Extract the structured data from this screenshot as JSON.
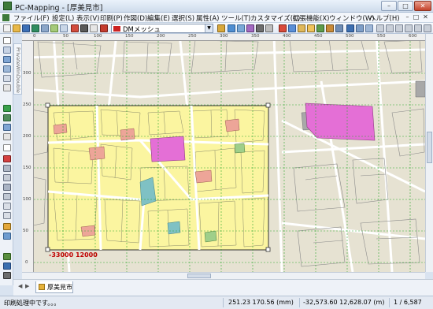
{
  "window": {
    "title": "PC-Mapping - [厚美見市]",
    "minimize_glyph": "–",
    "maximize_glyph": "□",
    "close_glyph": "✕"
  },
  "menu": {
    "items": [
      {
        "label": "ファイル(F)"
      },
      {
        "label": "設定(L)"
      },
      {
        "label": "表示(V)"
      },
      {
        "label": "印刷(P)"
      },
      {
        "label": "作図(D)"
      },
      {
        "label": "編集(E)"
      },
      {
        "label": "選択(S)"
      },
      {
        "label": "属性(A)"
      },
      {
        "label": "ツール(T)"
      },
      {
        "label": "カスタマイズ(C)"
      },
      {
        "label": "拡張機能(X)"
      },
      {
        "label": "ウィンドウ(W)"
      },
      {
        "label": "ヘルプ(H)"
      }
    ]
  },
  "toolbar": {
    "layer_select_value": "DMメッシュ"
  },
  "palette": {
    "label": "PrivateWinDouble"
  },
  "map": {
    "ruler_top_ticks": [
      "0",
      "50",
      "100",
      "150",
      "200",
      "250",
      "300",
      "350",
      "400",
      "450",
      "500",
      "550",
      "600"
    ],
    "ruler_left_ticks": [
      "300",
      "250",
      "200",
      "150",
      "100",
      "50",
      "0"
    ],
    "mesh_label": "-33000 12000",
    "colors": {
      "background": "#e6e2d2",
      "selected_sheet": "#fbf5a0",
      "mesh_grid": "#2fa82f",
      "outline": "#6f6f6f",
      "road": "#ffffff",
      "building_pink": "#e46fd6",
      "building_salmon": "#eda598",
      "building_teal": "#7fc1c4",
      "building_gray": "#a8a8a8",
      "building_green": "#9fcf8a",
      "mesh_label": "#c00000"
    }
  },
  "sheet_tab": {
    "label": "厚美見市"
  },
  "status": {
    "message": "印刷処理中です。。。",
    "cursor_mm": "251.23  170.56 (mm)",
    "cursor_m": "-32,573.60  12,628.07 (m)",
    "page": "1 / 6,587"
  }
}
